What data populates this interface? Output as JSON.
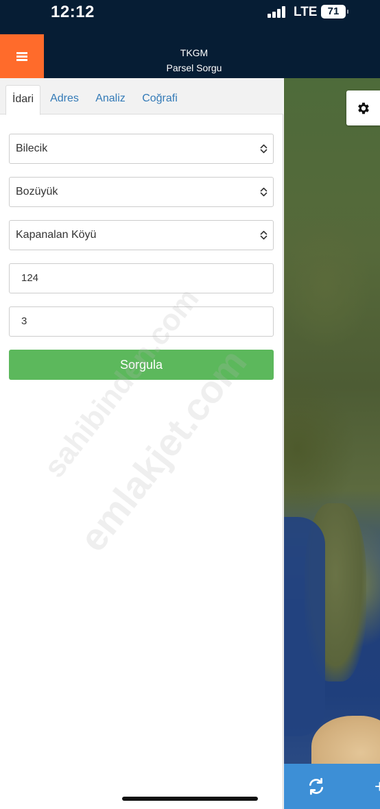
{
  "status_bar": {
    "time": "12:12",
    "network": "LTE",
    "battery": "71"
  },
  "header": {
    "title": "TKGM",
    "subtitle": "Parsel Sorgu"
  },
  "tabs": [
    {
      "label": "İdari",
      "active": true
    },
    {
      "label": "Adres",
      "active": false
    },
    {
      "label": "Analiz",
      "active": false
    },
    {
      "label": "Coğrafi",
      "active": false
    }
  ],
  "form": {
    "province": "Bilecik",
    "district": "Bozüyük",
    "neighborhood": "Kapanalan Köyü",
    "block": "124",
    "parcel": "3",
    "submit_label": "Sorgula"
  },
  "watermark": {
    "text1": "emlakjet.com",
    "text2": "sahibinden.com"
  },
  "map_controls": {
    "settings_icon": "gear-icon",
    "refresh_icon": "refresh-icon",
    "plus_icon": "plus-icon"
  },
  "colors": {
    "header_bg": "#061d34",
    "menu_accent": "#ff6b2b",
    "submit_green": "#5cb85c",
    "link_blue": "#337ab7",
    "bottom_bar": "#3d8fd6"
  }
}
